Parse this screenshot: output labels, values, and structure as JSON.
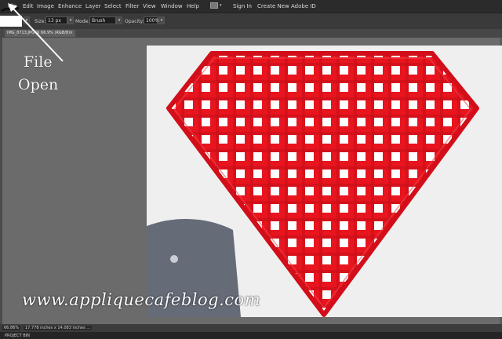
{
  "menubar": {
    "items": [
      "File",
      "Edit",
      "Image",
      "Enhance",
      "Layer",
      "Select",
      "Filter",
      "View",
      "Window",
      "Help"
    ],
    "sign_in": "Sign In",
    "create_id": "Create New Adobe ID"
  },
  "options": {
    "size_label": "Size:",
    "size_value": "13 px",
    "mode_label": "Mode:",
    "mode_value": "Brush",
    "opacity_label": "Opacity:",
    "opacity_value": "100%"
  },
  "document_tab": {
    "title": "IMG_8713.JPG @ 66.9% (RGB/8)",
    "close": "×"
  },
  "annotation": {
    "line1": "File",
    "line2": "Open"
  },
  "watermark": "www.appliquecafeblog.com",
  "status": {
    "zoom": "66.86%",
    "dimensions": "17.778 inches x 14.083 inches ..."
  },
  "project_bin": "PROJECT BIN",
  "colors": {
    "fabric_red": "#e01822",
    "stitch_red": "#c8101a",
    "background_white": "#efefef"
  }
}
